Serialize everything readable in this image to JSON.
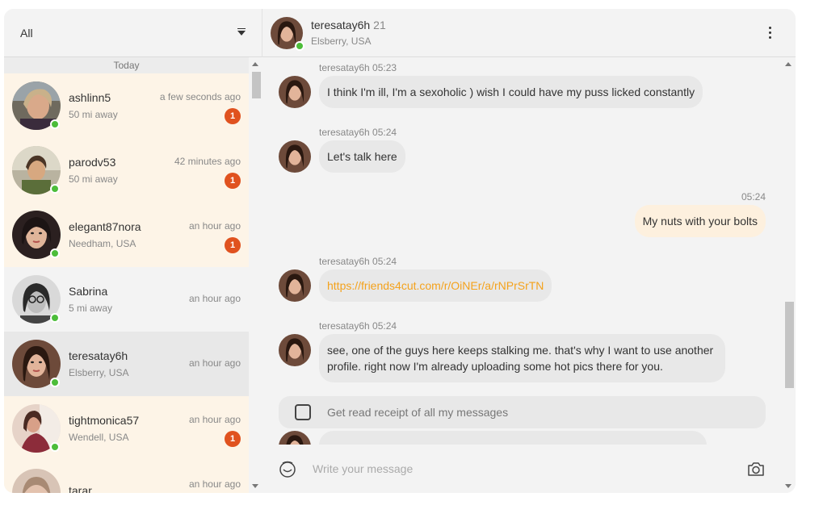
{
  "filter": {
    "label": "All"
  },
  "list": {
    "day_label": "Today",
    "conversations": [
      {
        "name": "ashlinn5",
        "sub": "50 mi away",
        "time": "a few seconds ago",
        "badge": "1"
      },
      {
        "name": "parodv53",
        "sub": "50 mi away",
        "time": "42 minutes ago",
        "badge": "1"
      },
      {
        "name": "elegant87nora",
        "sub": "Needham, USA",
        "time": "an hour ago",
        "badge": "1"
      },
      {
        "name": "Sabrina",
        "sub": "5 mi away",
        "time": "an hour ago"
      },
      {
        "name": "teresatay6h",
        "sub": "Elsberry, USA",
        "time": "an hour ago"
      },
      {
        "name": "tightmonica57",
        "sub": "Wendell, USA",
        "time": "an hour ago",
        "badge": "1"
      },
      {
        "name": "tarar",
        "sub": "",
        "time": "an hour ago"
      }
    ]
  },
  "header": {
    "name": "teresatay6h",
    "age": "21",
    "location": "Elsberry, USA"
  },
  "messages": [
    {
      "meta": "teresatay6h 05:23",
      "text": "I think I'm ill, I'm a sexoholic ) wish I could have my puss licked constantly"
    },
    {
      "meta": "teresatay6h 05:24",
      "text": "Let's talk here"
    },
    {
      "time": "05:24",
      "text": "My nuts with your bolts"
    },
    {
      "meta": "teresatay6h 05:24",
      "link": "https://friends4cut.com/r/OiNEr/a/rNPrSrTN"
    },
    {
      "meta": "teresatay6h 05:24",
      "text": "see, one of the guys here keeps stalking me. that's why I want to use another profile. right now I'm already uploading some hot pics there for you."
    }
  ],
  "receipt": {
    "label": "Get read receipt of all my messages"
  },
  "composer": {
    "placeholder": "Write your message"
  },
  "colors": {
    "online": "#4cbd3a",
    "badge": "#e0521f",
    "link": "#f4a21c",
    "unread_bg": "#fdf4e7"
  }
}
